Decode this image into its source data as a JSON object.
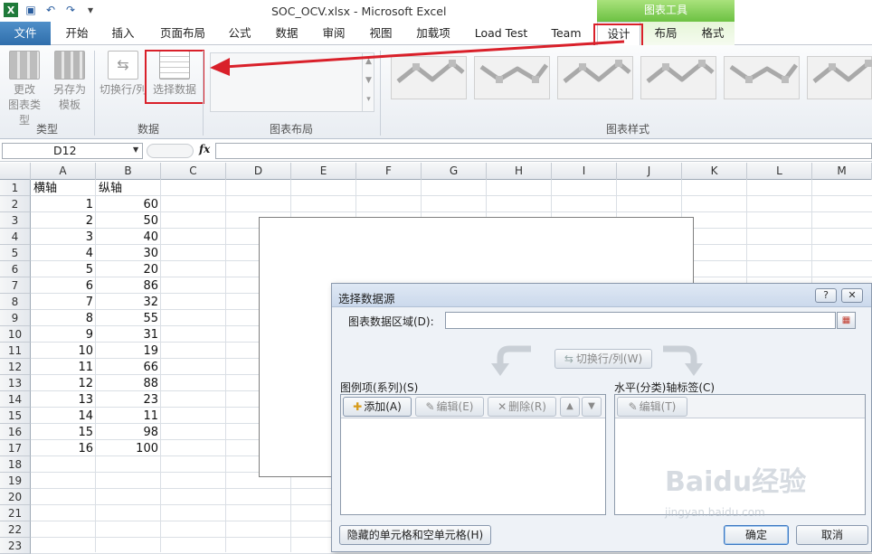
{
  "window": {
    "title": "SOC_OCV.xlsx - Microsoft Excel",
    "context_tab_group": "图表工具"
  },
  "ribbon_tabs": [
    "文件",
    "开始",
    "插入",
    "页面布局",
    "公式",
    "数据",
    "审阅",
    "视图",
    "加载项",
    "Load Test",
    "Team",
    "设计",
    "布局",
    "格式"
  ],
  "active_tab": "设计",
  "ribbon": {
    "change_chart_type": [
      "更改",
      "图表类型"
    ],
    "save_as_template": [
      "另存为",
      "模板"
    ],
    "switch_row_col": "切换行/列",
    "select_data": "选择数据",
    "groups": {
      "type": "类型",
      "data": "数据",
      "layouts": "图表布局",
      "styles": "图表样式"
    }
  },
  "formula_bar": {
    "name_box": "D12",
    "fx_label": "fx",
    "value": ""
  },
  "columns": [
    "A",
    "B",
    "C",
    "D",
    "E",
    "F",
    "G",
    "H",
    "I",
    "J",
    "K",
    "L",
    "M"
  ],
  "rows": [
    "1",
    "2",
    "3",
    "4",
    "5",
    "6",
    "7",
    "8",
    "9",
    "10",
    "11",
    "12",
    "13",
    "14",
    "15",
    "16",
    "17",
    "18",
    "19",
    "20",
    "21",
    "22",
    "23"
  ],
  "sheet": {
    "header_a": "横轴",
    "header_b": "纵轴",
    "data": [
      [
        "1",
        "60"
      ],
      [
        "2",
        "50"
      ],
      [
        "3",
        "40"
      ],
      [
        "4",
        "30"
      ],
      [
        "5",
        "20"
      ],
      [
        "6",
        "86"
      ],
      [
        "7",
        "32"
      ],
      [
        "8",
        "55"
      ],
      [
        "9",
        "31"
      ],
      [
        "10",
        "19"
      ],
      [
        "11",
        "66"
      ],
      [
        "12",
        "88"
      ],
      [
        "13",
        "23"
      ],
      [
        "14",
        "11"
      ],
      [
        "15",
        "98"
      ],
      [
        "16",
        "100"
      ]
    ]
  },
  "dialog": {
    "title": "选择数据源",
    "help": "?",
    "close": "✕",
    "range_label": "图表数据区域(D):",
    "range_value": "",
    "switch_label": "切换行/列(W)",
    "legend_label": "图例项(系列)(S)",
    "add_label": "添加(A)",
    "edit_label": "编辑(E)",
    "remove_label": "删除(R)",
    "axis_label": "水平(分类)轴标签(C)",
    "axis_edit_label": "编辑(T)",
    "hidden_cells_label": "隐藏的单元格和空单元格(H)",
    "ok_label": "确定",
    "cancel_label": "取消"
  },
  "watermark": {
    "text": "Baidu经验",
    "url": "jingyan.baidu.com"
  },
  "colors": {
    "annotation_red": "#d9202a",
    "file_tab": "#2f6eab",
    "context_green": "#6cc142"
  }
}
